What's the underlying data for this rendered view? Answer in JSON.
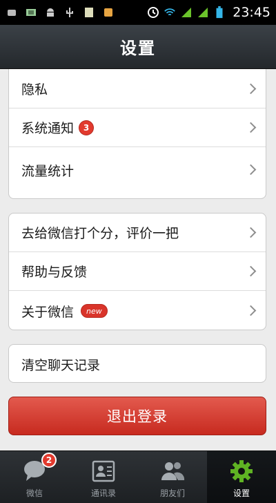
{
  "status_bar": {
    "time": "23:45",
    "icons": [
      "sync-icon",
      "sim-icon",
      "android-icon",
      "usb-icon",
      "sd-card-icon",
      "notification-icon",
      "alarm-icon",
      "wifi-icon",
      "signal-icon",
      "signal-icon-2",
      "battery-icon"
    ]
  },
  "header": {
    "title": "设置"
  },
  "settings": {
    "group1": [
      {
        "label": "隐私"
      },
      {
        "label": "系统通知",
        "badge": "3"
      },
      {
        "label": "流量统计"
      }
    ],
    "group2": [
      {
        "label": "去给微信打个分，评价一把"
      },
      {
        "label": "帮助与反馈"
      },
      {
        "label": "关于微信",
        "badge": "new"
      }
    ],
    "group3": [
      {
        "label": "清空聊天记录"
      }
    ],
    "logout_label": "退出登录"
  },
  "tabs": [
    {
      "label": "微信",
      "badge": "2",
      "icon": "chat-bubble-icon"
    },
    {
      "label": "通讯录",
      "icon": "contacts-card-icon"
    },
    {
      "label": "朋友们",
      "icon": "friends-icon"
    },
    {
      "label": "设置",
      "icon": "gear-icon",
      "active": true
    }
  ],
  "colors": {
    "accent_red": "#d9342a",
    "active_tab_green": "#5fb323"
  }
}
